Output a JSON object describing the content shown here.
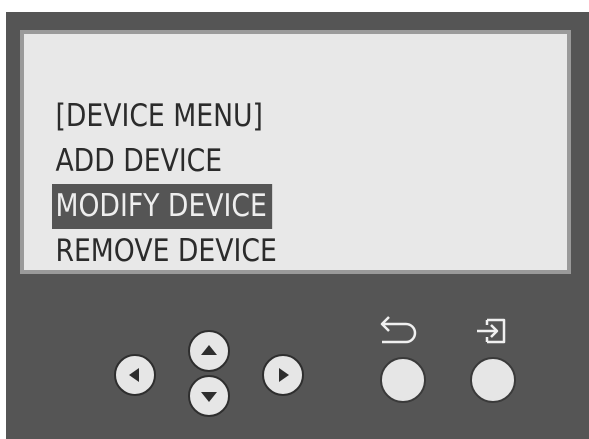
{
  "screen": {
    "title": "[DEVICE MENU]",
    "items": [
      {
        "label": "ADD DEVICE",
        "selected": false
      },
      {
        "label": "MODIFY DEVICE",
        "selected": true
      },
      {
        "label": "REMOVE DEVICE",
        "selected": false
      }
    ]
  },
  "keypad": {
    "left": {
      "icon": "left-arrow-icon"
    },
    "up": {
      "icon": "up-arrow-icon"
    },
    "down": {
      "icon": "down-arrow-icon"
    },
    "right": {
      "icon": "right-arrow-icon"
    },
    "back": {
      "legend_icon": "back-return-icon"
    },
    "enter": {
      "legend_icon": "enter-login-icon"
    }
  },
  "colors": {
    "panel": "#555555",
    "screen_bg": "#e8e8e8",
    "screen_border": "#9a9a9a",
    "text": "#2b2b2b",
    "highlight_bg": "#555555",
    "highlight_text": "#eeeeee",
    "button_face": "#e6e6e6"
  }
}
